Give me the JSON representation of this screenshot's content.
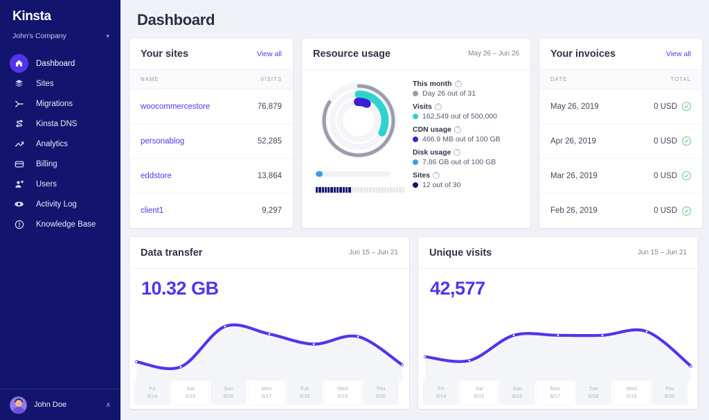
{
  "brand": {
    "logo": "Kinsta",
    "company": "John's Company"
  },
  "sidebar": {
    "items": [
      {
        "label": "Dashboard",
        "icon": "home-icon",
        "active": true
      },
      {
        "label": "Sites",
        "icon": "layers-icon",
        "active": false
      },
      {
        "label": "Migrations",
        "icon": "migration-icon",
        "active": false
      },
      {
        "label": "Kinsta DNS",
        "icon": "dns-icon",
        "active": false
      },
      {
        "label": "Analytics",
        "icon": "analytics-icon",
        "active": false
      },
      {
        "label": "Billing",
        "icon": "billing-icon",
        "active": false
      },
      {
        "label": "Users",
        "icon": "user-add-icon",
        "active": false
      },
      {
        "label": "Activity Log",
        "icon": "eye-icon",
        "active": false
      },
      {
        "label": "Knowledge Base",
        "icon": "help-icon",
        "active": false
      }
    ],
    "user": {
      "name": "John Doe",
      "chevron": "∧"
    }
  },
  "header": {
    "title": "Dashboard"
  },
  "sites_card": {
    "title": "Your sites",
    "view_all": "View all",
    "columns": [
      "NAME",
      "VISITS"
    ],
    "rows": [
      {
        "name": "woocommercestore",
        "visits": "76,879"
      },
      {
        "name": "personablog",
        "visits": "52,285"
      },
      {
        "name": "eddstore",
        "visits": "13,864"
      },
      {
        "name": "client1",
        "visits": "9,297"
      }
    ]
  },
  "resource_card": {
    "title": "Resource usage",
    "range": "May 26 – Jun 26",
    "metrics": [
      {
        "label": "This month",
        "value": "Day 26 out of 31",
        "color": "#9A9CAD",
        "pct": 83.9
      },
      {
        "label": "Visits",
        "value": "162,549 out of 500,000",
        "color": "#2DD4CE",
        "pct": 32.5
      },
      {
        "label": "CDN usage",
        "value": "466.9 MB out of 100 GB",
        "color": "#3D1FD4",
        "pct": 6.5
      },
      {
        "label": "Disk usage",
        "value": "7.86 GB out of 100 GB",
        "color": "#3B9BE8",
        "pct": 7.9
      },
      {
        "label": "Sites",
        "value": "12 out of 30",
        "color": "#13146E",
        "pct": 40
      }
    ],
    "sites_filled": 12,
    "sites_total": 30,
    "help_glyph": "?"
  },
  "invoices_card": {
    "title": "Your invoices",
    "view_all": "View all",
    "columns": [
      "DATE",
      "TOTAL"
    ],
    "rows": [
      {
        "date": "May 26, 2019",
        "total": "0 USD",
        "status": "paid"
      },
      {
        "date": "Apr 26, 2019",
        "total": "0 USD",
        "status": "paid"
      },
      {
        "date": "Mar 26, 2019",
        "total": "0 USD",
        "status": "paid"
      },
      {
        "date": "Feb 26, 2019",
        "total": "0 USD",
        "status": "paid"
      }
    ]
  },
  "chart_data": [
    {
      "type": "line",
      "title": "Data transfer",
      "range": "Jun 15 – Jun 21",
      "total": "10.32 GB",
      "xlabel": "",
      "ylabel": "",
      "categories": [
        "Fri",
        "Sat",
        "Sun",
        "Mon",
        "Tue",
        "Wed",
        "Thu"
      ],
      "tick_dates": [
        "6/14",
        "6/15",
        "6/16",
        "6/17",
        "6/18",
        "6/19",
        "6/20"
      ],
      "values": [
        22,
        14,
        78,
        66,
        50,
        62,
        17
      ],
      "ylim": [
        0,
        100
      ],
      "grid": false,
      "legend": "none",
      "line_color": "#5333ED"
    },
    {
      "type": "line",
      "title": "Unique visits",
      "range": "Jun 15 – Jun 21",
      "total": "42,577",
      "xlabel": "",
      "ylabel": "",
      "categories": [
        "Fri",
        "Sat",
        "Sun",
        "Mon",
        "Tue",
        "Wed",
        "Thu"
      ],
      "tick_dates": [
        "6/14",
        "6/15",
        "6/16",
        "6/17",
        "6/18",
        "6/19",
        "6/20"
      ],
      "values": [
        30,
        24,
        64,
        64,
        64,
        70,
        15
      ],
      "ylim": [
        0,
        100
      ],
      "grid": false,
      "legend": "none",
      "line_color": "#5333ED"
    }
  ]
}
